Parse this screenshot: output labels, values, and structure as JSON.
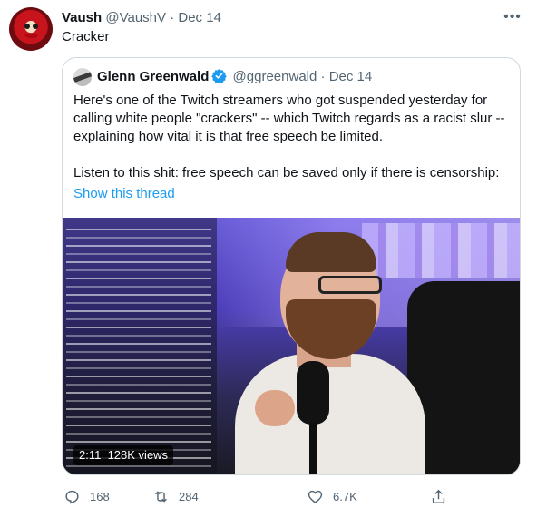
{
  "tweet": {
    "author_name": "Vaush",
    "author_handle": "@VaushV",
    "separator": "·",
    "date": "Dec 14",
    "text": "Cracker"
  },
  "quoted": {
    "author_name": "Glenn Greenwald",
    "author_handle": "@ggreenwald",
    "separator": "·",
    "date": "Dec 14",
    "paragraph1": "Here's one of the Twitch streamers who got suspended yesterday for calling white people \"crackers\" -- which Twitch regards as a racist slur -- explaining how vital it is that free speech be limited.",
    "paragraph2": "Listen to this shit: free speech can be saved only if there is censorship:",
    "show_thread": "Show this thread",
    "video": {
      "time": "2:11",
      "views": "128K views"
    }
  },
  "actions": {
    "replies": "168",
    "retweets": "284",
    "likes": "6.7K"
  },
  "colors": {
    "link": "#1d9bf0",
    "secondary_text": "#536471",
    "verified": "#1d9bf0"
  },
  "icons": [
    "more-icon",
    "verified-badge-icon",
    "reply-icon",
    "retweet-icon",
    "like-icon",
    "share-icon"
  ]
}
